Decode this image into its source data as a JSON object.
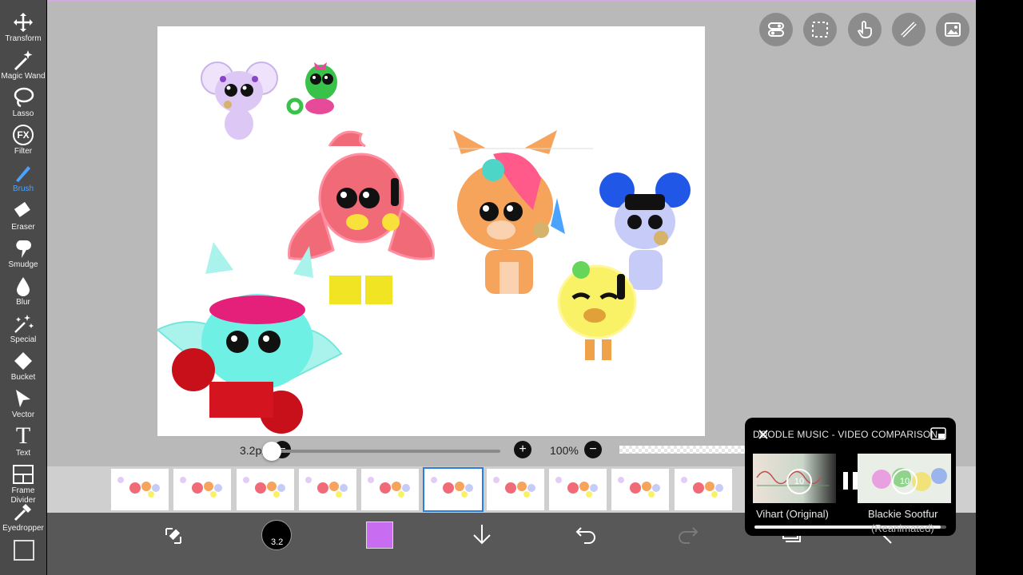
{
  "toolbar": {
    "tools": [
      {
        "label": "Transform",
        "icon": "move-arrows-icon"
      },
      {
        "label": "Magic Wand",
        "icon": "magic-wand-icon"
      },
      {
        "label": "Lasso",
        "icon": "lasso-icon"
      },
      {
        "label": "Filter",
        "icon": "fx-icon"
      },
      {
        "label": "Brush",
        "icon": "brush-icon",
        "active": true
      },
      {
        "label": "Eraser",
        "icon": "eraser-icon"
      },
      {
        "label": "Smudge",
        "icon": "smudge-icon"
      },
      {
        "label": "Blur",
        "icon": "drop-icon"
      },
      {
        "label": "Special",
        "icon": "sparkle-wand-icon"
      },
      {
        "label": "Bucket",
        "icon": "bucket-icon"
      },
      {
        "label": "Vector",
        "icon": "cursor-arrow-icon"
      },
      {
        "label": "Text",
        "icon": "text-t-icon"
      },
      {
        "label": "Frame Divider",
        "icon": "frame-divider-icon"
      },
      {
        "label": "Eyedropper",
        "icon": "eyedropper-icon"
      }
    ],
    "filter_glyph": "FX",
    "text_glyph": "T",
    "active_color": "#4aa3ff"
  },
  "quick_icons": [
    "toggle-icon",
    "selection-marquee-icon",
    "hand-pointer-icon",
    "ruler-pen-icon",
    "image-layer-icon"
  ],
  "brush_controls": {
    "size_value": "3.2px",
    "size_fraction": 0.02,
    "opacity_value": "100%",
    "minus": "−",
    "plus": "+"
  },
  "frames": {
    "count_visible": 10,
    "selected_index": 5
  },
  "bottom_bar": {
    "brush_size_badge": "3.2",
    "current_color": "#c86cf2",
    "icons": [
      "swap-tools-icon",
      "brush-size-icon",
      "color-swatch-icon",
      "download-arrow-icon",
      "undo-icon",
      "redo-icon",
      "layers-icon",
      "back-icon"
    ]
  },
  "pip": {
    "title": "DOODLE MUSIC - VIDEO COMPARISON",
    "left_caption": "Vihart (Original)",
    "right_caption": "Blackie Sootfur",
    "right_subcaption": "(Reanimated)",
    "skip_label": "10",
    "progress": 0.97
  }
}
